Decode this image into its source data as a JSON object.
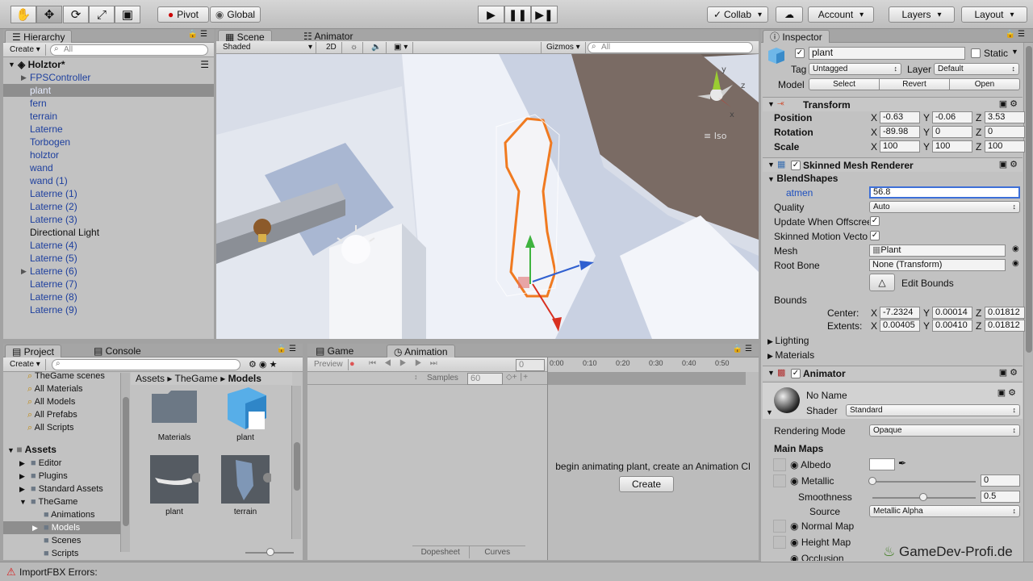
{
  "toolbar": {
    "tools": [
      "hand-icon",
      "move-icon",
      "rotate-icon",
      "scale-icon",
      "rect-icon"
    ],
    "pivot_label": "Pivot",
    "global_label": "Global",
    "collab_label": "Collab",
    "account_label": "Account",
    "layers_label": "Layers",
    "layout_label": "Layout"
  },
  "hierarchy": {
    "tab": "Hierarchy",
    "create": "Create",
    "search_placeholder": "All",
    "scene_name": "Holztor*",
    "items": [
      {
        "label": "FPSController",
        "expandable": true
      },
      {
        "label": "plant",
        "selected": true
      },
      {
        "label": "fern"
      },
      {
        "label": "terrain"
      },
      {
        "label": "Laterne"
      },
      {
        "label": "Torbogen"
      },
      {
        "label": "holztor"
      },
      {
        "label": "wand"
      },
      {
        "label": "wand (1)"
      },
      {
        "label": "Laterne (1)"
      },
      {
        "label": "Laterne (2)"
      },
      {
        "label": "Laterne (3)"
      },
      {
        "label": "Directional Light",
        "black": true
      },
      {
        "label": "Laterne (4)"
      },
      {
        "label": "Laterne (5)"
      },
      {
        "label": "Laterne (6)",
        "expandable": true
      },
      {
        "label": "Laterne (7)"
      },
      {
        "label": "Laterne (8)"
      },
      {
        "label": "Laterne (9)"
      }
    ]
  },
  "scene": {
    "tab_scene": "Scene",
    "tab_animator": "Animator",
    "shading": "Shaded",
    "mode_2d": "2D",
    "gizmos": "Gizmos",
    "search_placeholder": "All",
    "persp_label": "Iso",
    "axis_y": "y",
    "axis_z": "z",
    "axis_x": "x"
  },
  "project": {
    "tab_project": "Project",
    "tab_console": "Console",
    "create": "Create",
    "favorites": [
      "TheGame scenes",
      "All Materials",
      "All Models",
      "All Prefabs",
      "All Scripts"
    ],
    "assets_root": "Assets",
    "tree": [
      {
        "label": "Editor",
        "depth": 1,
        "expandable": true
      },
      {
        "label": "Plugins",
        "depth": 1,
        "expandable": true
      },
      {
        "label": "Standard Assets",
        "depth": 1,
        "expandable": true
      },
      {
        "label": "TheGame",
        "depth": 1,
        "expanded": true
      },
      {
        "label": "Animations",
        "depth": 2
      },
      {
        "label": "Models",
        "depth": 2,
        "selected": true,
        "expandable": true
      },
      {
        "label": "Scenes",
        "depth": 2
      },
      {
        "label": "Scripts",
        "depth": 2
      }
    ],
    "breadcrumb": [
      "Assets",
      "TheGame",
      "Models"
    ],
    "assets": [
      {
        "label": "Materials",
        "kind": "folder"
      },
      {
        "label": "plant",
        "kind": "cube"
      },
      {
        "label": "plant",
        "kind": "model"
      },
      {
        "label": "terrain",
        "kind": "model"
      }
    ]
  },
  "game_tab": "Game",
  "animation": {
    "tab": "Animation",
    "preview": "Preview",
    "frame": "0",
    "samples_label": "Samples",
    "samples_value": "60",
    "ticks": [
      "0:00",
      "0:10",
      "0:20",
      "0:30",
      "0:40",
      "0:50"
    ],
    "message": "begin animating plant, create an Animation Cl",
    "create_button": "Create",
    "dopesheet": "Dopesheet",
    "curves": "Curves"
  },
  "inspector": {
    "tab": "Inspector",
    "object_name": "plant",
    "static_label": "Static",
    "tag_label": "Tag",
    "tag_value": "Untagged",
    "layer_label": "Layer",
    "layer_value": "Default",
    "model_label": "Model",
    "select": "Select",
    "revert": "Revert",
    "open": "Open",
    "transform": {
      "title": "Transform",
      "position_label": "Position",
      "position": [
        "-0.63",
        "-0.06",
        "3.53"
      ],
      "rotation_label": "Rotation",
      "rotation": [
        "-89.98",
        "0",
        "0"
      ],
      "scale_label": "Scale",
      "scale": [
        "100",
        "100",
        "100"
      ]
    },
    "smr": {
      "title": "Skinned Mesh Renderer",
      "blendshapes_label": "BlendShapes",
      "atmen_label": "atmen",
      "atmen_value": "56.8",
      "quality_label": "Quality",
      "quality_value": "Auto",
      "update_offscreen_label": "Update When Offscree",
      "motion_vectors_label": "Skinned Motion Vecto",
      "mesh_label": "Mesh",
      "mesh_value": "Plant",
      "rootbone_label": "Root Bone",
      "rootbone_value": "None (Transform)",
      "edit_bounds": "Edit Bounds",
      "bounds_label": "Bounds",
      "center_label": "Center:",
      "center": [
        "-7.2324",
        "0.00014",
        "0.01812"
      ],
      "extents_label": "Extents:",
      "extents": [
        "0.00405",
        "0.00410",
        "0.01812"
      ],
      "lighting": "Lighting",
      "materials": "Materials"
    },
    "animator_title": "Animator",
    "material": {
      "name": "No Name",
      "shader_label": "Shader",
      "shader_value": "Standard",
      "rendering_mode_label": "Rendering Mode",
      "rendering_mode_value": "Opaque",
      "main_maps": "Main Maps",
      "albedo": "Albedo",
      "metallic": "Metallic",
      "metallic_value": "0",
      "smoothness": "Smoothness",
      "smoothness_value": "0.5",
      "source": "Source",
      "source_value": "Metallic Alpha",
      "normal_map": "Normal Map",
      "height_map": "Height Map",
      "occlusion": "Occlusion"
    },
    "watermark": "GameDev-Profi.de"
  },
  "status": {
    "message": "ImportFBX Errors:"
  },
  "axis_labels": [
    "X",
    "Y",
    "Z"
  ]
}
